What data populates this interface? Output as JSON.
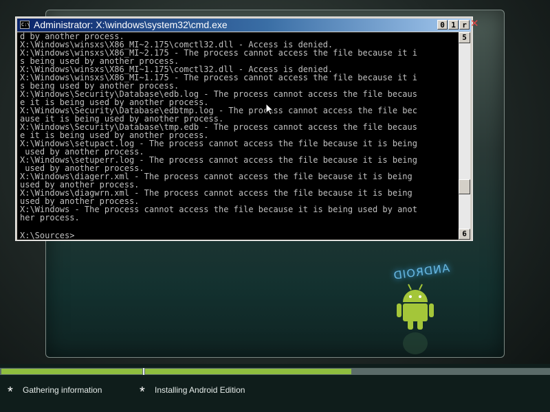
{
  "console_window": {
    "title": "Administrator: X:\\windows\\system32\\cmd.exe",
    "controls": [
      "0",
      "1",
      "r"
    ],
    "close_glyph": "✕",
    "lines": [
      "d by another process.",
      "X:\\Windows\\winsxs\\X86_MI~2.175\\comctl32.dll - Access is denied.",
      "X:\\Windows\\winsxs\\X86_MI~2.175 - The process cannot access the file because it i",
      "s being used by another process.",
      "X:\\Windows\\winsxs\\X86_MI~1.175\\comctl32.dll - Access is denied.",
      "X:\\Windows\\winsxs\\X86_MI~1.175 - The process cannot access the file because it i",
      "s being used by another process.",
      "X:\\Windows\\Security\\Database\\edb.log - The process cannot access the file becaus",
      "e it is being used by another process.",
      "X:\\Windows\\Security\\Database\\edbtmp.log - The process cannot access the file bec",
      "ause it is being used by another process.",
      "X:\\Windows\\Security\\Database\\tmp.edb - The process cannot access the file becaus",
      "e it is being used by another process.",
      "X:\\Windows\\setupact.log - The process cannot access the file because it is being",
      " used by another process.",
      "X:\\Windows\\setuperr.log - The process cannot access the file because it is being",
      " used by another process.",
      "X:\\Windows\\diagerr.xml - The process cannot access the file because it is being",
      "used by another process.",
      "X:\\Windows\\diagwrn.xml - The process cannot access the file because it is being",
      "used by another process.",
      "X:\\Windows - The process cannot access the file because it is being used by anot",
      "her process."
    ],
    "prompt": "X:\\Sources>_",
    "scroll_up_glyph": "5",
    "scroll_down_glyph": "6"
  },
  "wallpaper": {
    "logo_text": "ANDROID"
  },
  "setup_progress": {
    "steps": [
      {
        "label": "Gathering information",
        "marker": "*"
      },
      {
        "label": "Installing Android Edition",
        "marker": "*"
      }
    ],
    "colors": {
      "fill": "#8fbe3f",
      "track": "#5b6b69"
    }
  }
}
